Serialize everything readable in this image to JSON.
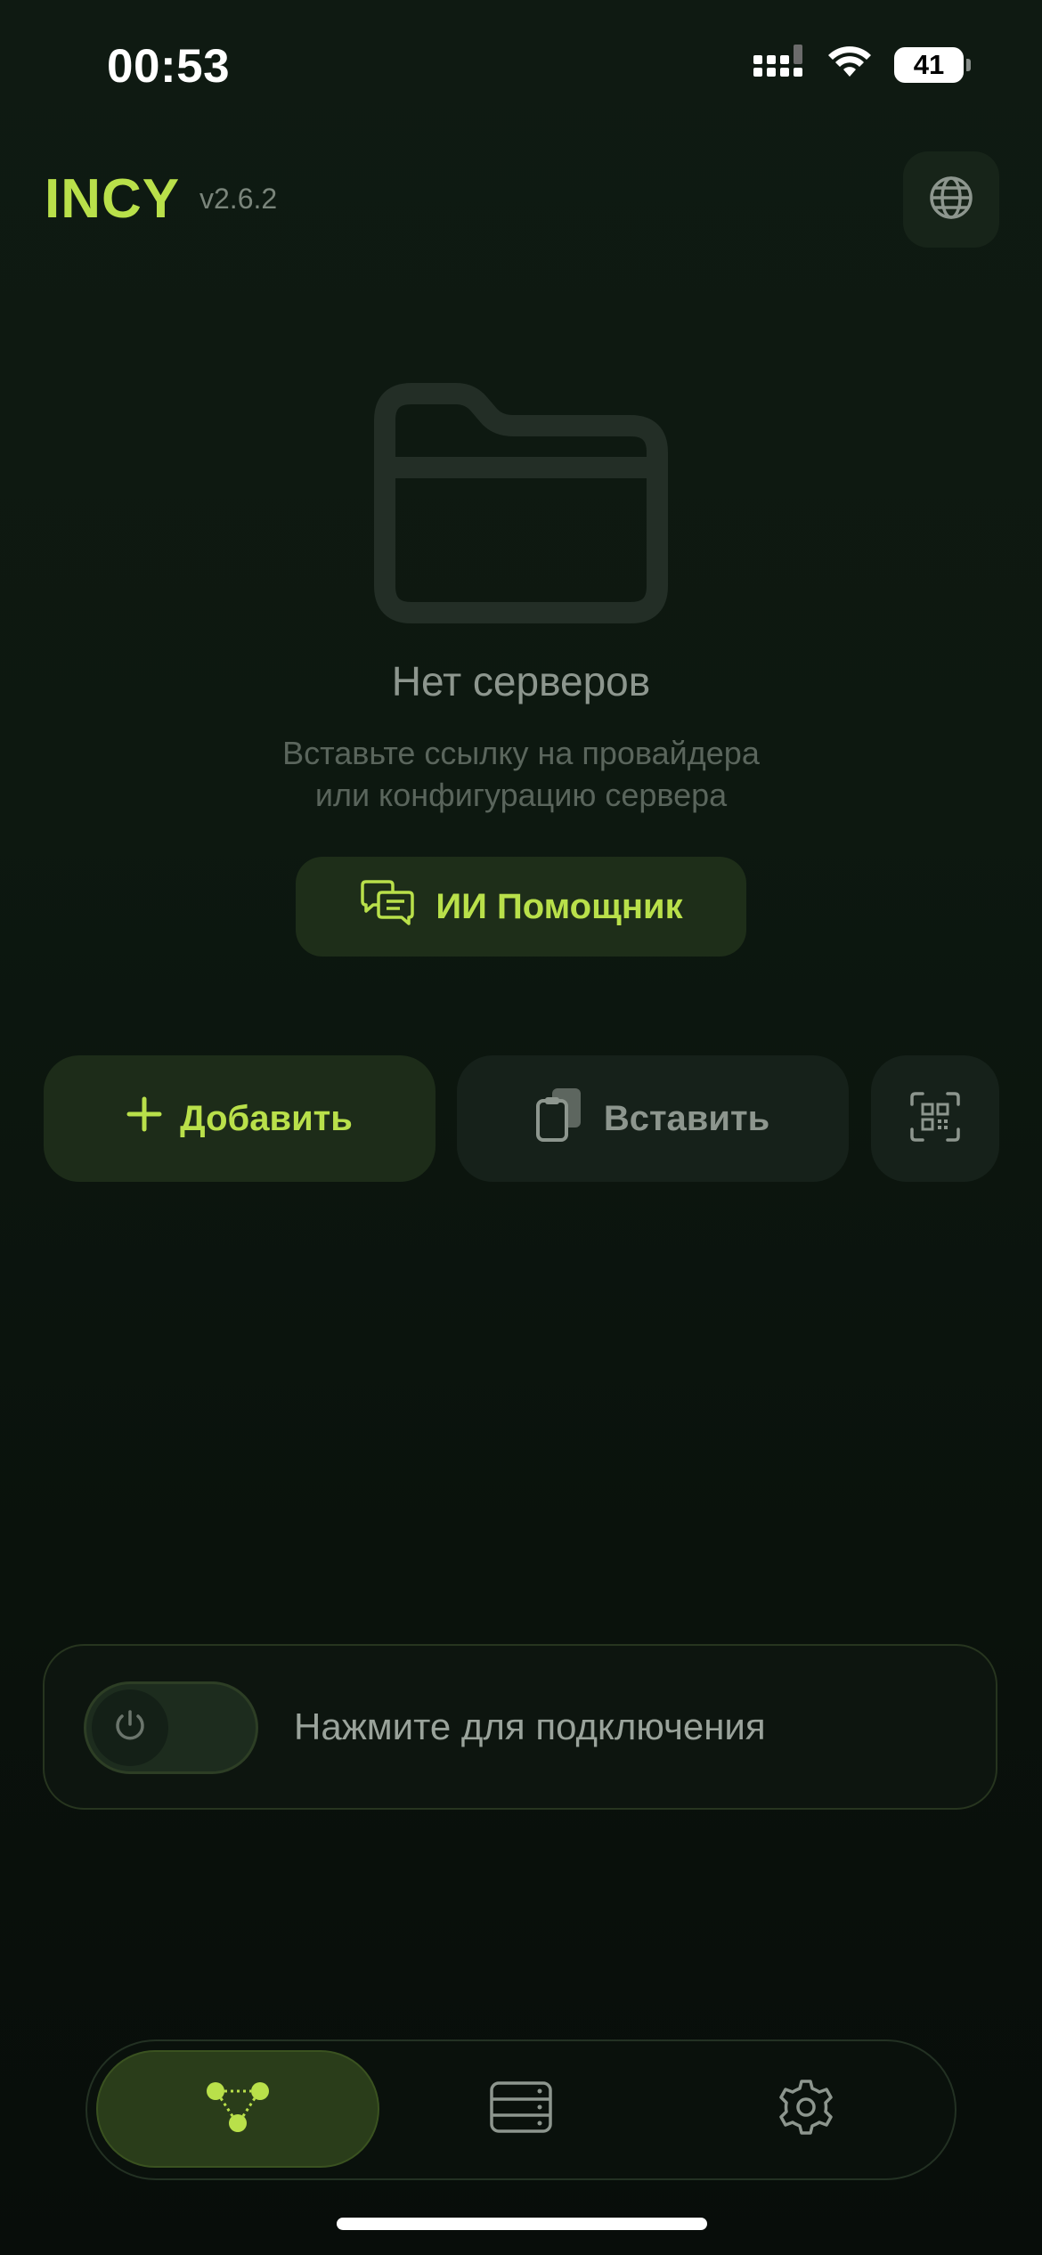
{
  "status_bar": {
    "time": "00:53",
    "battery_level": "41",
    "signal_icon": "cellular-signal-icon",
    "wifi_icon": "wifi-icon",
    "battery_icon": "battery-icon"
  },
  "header": {
    "brand": "INCY",
    "version": "v2.6.2",
    "language_icon": "globe-icon"
  },
  "empty_state": {
    "icon": "folder-icon",
    "title": "Нет серверов",
    "subtitle_line1": "Вставьте ссылку на провайдера",
    "subtitle_line2": "или конфигурацию сервера"
  },
  "assistant_button": {
    "label": "ИИ Помощник",
    "icon": "chat-bubbles-icon"
  },
  "actions": {
    "add_label": "Добавить",
    "add_icon": "plus-icon",
    "paste_label": "Вставить",
    "paste_icon": "clipboard-icon",
    "scan_icon": "qr-scan-icon"
  },
  "connect": {
    "label": "Нажмите для подключения",
    "power_icon": "power-icon",
    "connected": false
  },
  "nav": {
    "items": [
      {
        "icon": "nodes-icon",
        "active": true
      },
      {
        "icon": "servers-icon",
        "active": false
      },
      {
        "icon": "gear-icon",
        "active": false
      }
    ]
  },
  "colors": {
    "accent": "#b9e04a",
    "background": "#0d1810",
    "muted_text": "#8d968e"
  }
}
